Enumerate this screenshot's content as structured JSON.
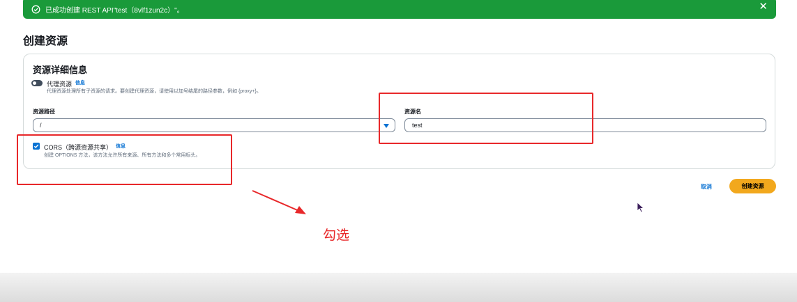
{
  "banner": {
    "message": "已成功创建 REST API\"test（8vlf1zun2c）\"。",
    "close_glyph": "✕",
    "color": "#1a9a3a"
  },
  "page": {
    "title": "创建资源"
  },
  "card": {
    "title": "资源详细信息",
    "proxy": {
      "label": "代理资源",
      "info": "信息",
      "description": "代理资源处理所有子资源的请求。要创建代理资源，请使用以加号结尾的路径参数，例如 {proxy+}。",
      "enabled": false
    },
    "path": {
      "label": "资源路径",
      "value": "/"
    },
    "name": {
      "label": "资源名",
      "value": "test"
    },
    "cors": {
      "label": "CORS（跨源资源共享）",
      "info": "信息",
      "description": "创建 OPTIONS 方法，该方法允许所有来源、所有方法和多个常用标头。",
      "checked": true
    }
  },
  "actions": {
    "cancel": "取消",
    "create": "创建资源",
    "create_color": "#f2a81d"
  },
  "annotation": {
    "text": "勾选",
    "color": "#e8282a"
  }
}
